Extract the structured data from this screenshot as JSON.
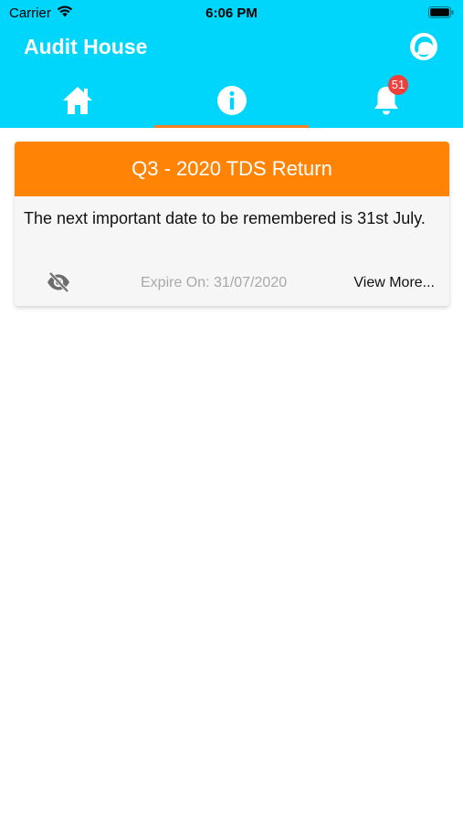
{
  "status_bar": {
    "carrier": "Carrier",
    "time": "6:06 PM"
  },
  "header": {
    "title": "Audit House",
    "avatar_icon": "user-avatar-icon"
  },
  "tabs": [
    {
      "name": "home",
      "icon": "home-icon",
      "active": false
    },
    {
      "name": "info",
      "icon": "info-icon",
      "active": true
    },
    {
      "name": "notifications",
      "icon": "bell-icon",
      "active": false,
      "badge": "51"
    }
  ],
  "colors": {
    "header": "#00d5fb",
    "card_header": "#ff8406",
    "tab_indicator": "#f58023",
    "badge": "#f0403c"
  },
  "card": {
    "title": "Q3 - 2020 TDS Return",
    "body": "The next important date to be remembered is 31st July.",
    "expire": "Expire On: 31/07/2020",
    "view_more": "View More...",
    "visibility_icon": "eye-off-icon"
  }
}
